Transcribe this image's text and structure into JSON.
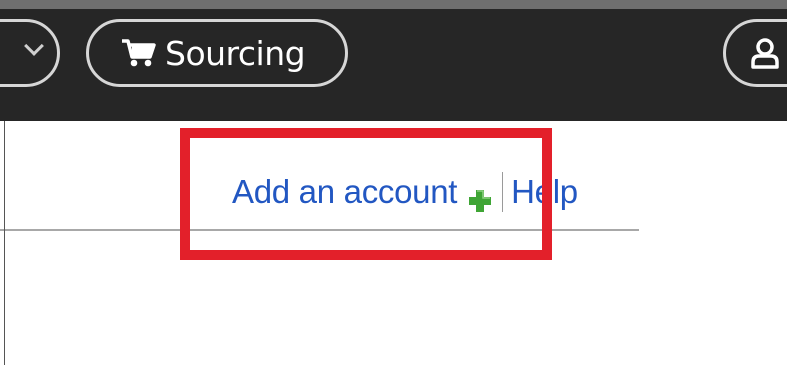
{
  "nav": {
    "sourcing_label": "Sourcing",
    "icons": {
      "left": "chevron-down-icon",
      "sourcing": "cart-icon",
      "user": "user-icon"
    }
  },
  "links": {
    "add_account": "Add an account",
    "help": "Help"
  },
  "colors": {
    "navbar": "#262626",
    "link": "#2257c2",
    "plus": "#3fa535",
    "highlight": "#e3202a"
  }
}
